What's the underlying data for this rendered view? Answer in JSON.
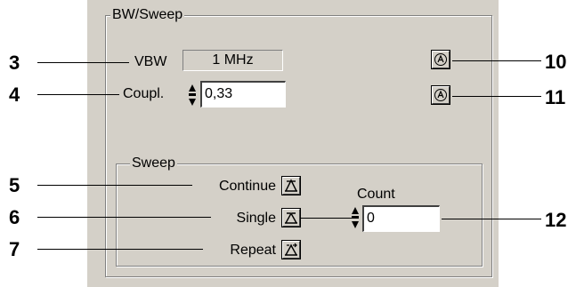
{
  "group_bw": {
    "title": "BW/Sweep"
  },
  "vbw": {
    "label": "VBW",
    "value": "1 MHz"
  },
  "coupl": {
    "label": "Coupl.",
    "value": "0,33"
  },
  "group_sweep": {
    "title": "Sweep"
  },
  "sweep_modes": {
    "continue_label": "Continue",
    "single_label": "Single",
    "repeat_label": "Repeat"
  },
  "count": {
    "label": "Count",
    "value": "0"
  },
  "callouts": {
    "n3": "3",
    "n4": "4",
    "n5": "5",
    "n6": "6",
    "n7": "7",
    "n10": "10",
    "n11": "11",
    "n12": "12"
  },
  "icons": {
    "auto_button": "auto-mode-icon",
    "sweep_continue": "sweep-continuous-icon",
    "sweep_single": "sweep-single-icon",
    "sweep_repeat": "sweep-repeat-icon"
  },
  "colors": {
    "panel": "#d4d0c8",
    "input_bg": "#ffffff",
    "text": "#000000"
  }
}
